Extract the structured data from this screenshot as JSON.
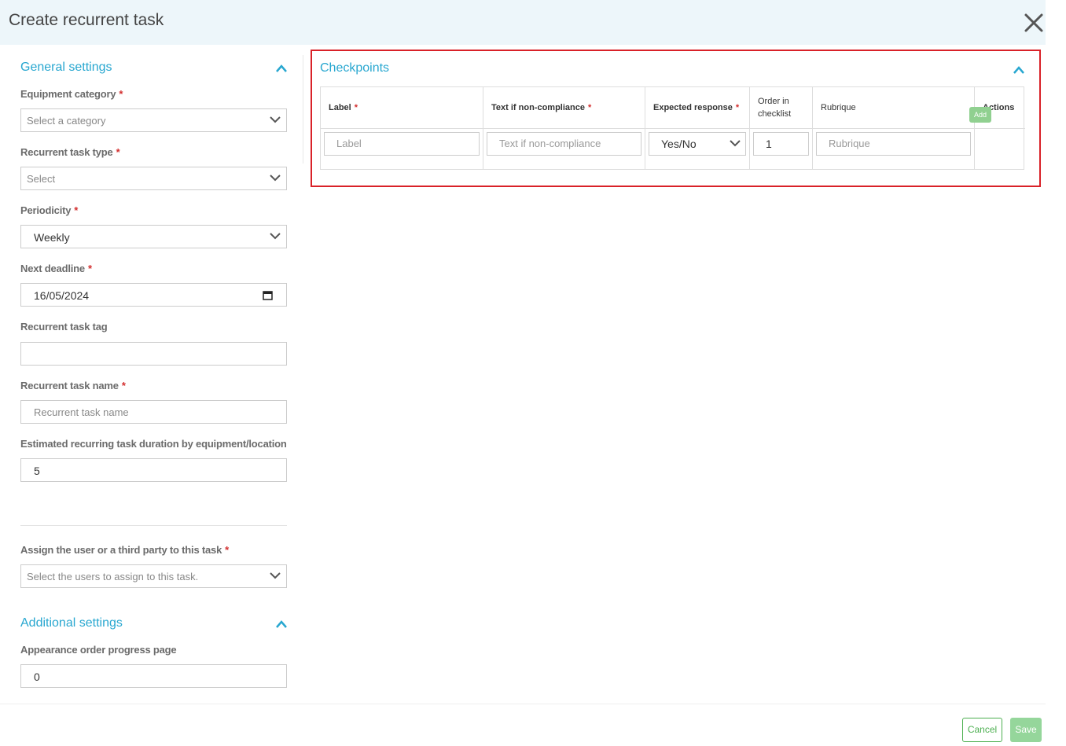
{
  "header": {
    "title": "Create recurrent task"
  },
  "general": {
    "title": "General settings",
    "equipment_category": {
      "label": "Equipment category",
      "placeholder": "Select a category"
    },
    "task_type": {
      "label": "Recurrent task type",
      "placeholder": "Select"
    },
    "periodicity": {
      "label": "Periodicity",
      "value": "Weekly"
    },
    "next_deadline": {
      "label": "Next deadline",
      "value": "16/05/2024"
    },
    "task_tag": {
      "label": "Recurrent task tag",
      "value": ""
    },
    "task_name": {
      "label": "Recurrent task name",
      "placeholder": "Recurrent task name"
    },
    "duration": {
      "label": "Estimated recurring task duration by equipment/location",
      "value": "5"
    },
    "assign": {
      "label": "Assign the user or a third party to this task",
      "placeholder": "Select the users to assign to this task."
    }
  },
  "additional": {
    "title": "Additional settings",
    "appearance_order": {
      "label": "Appearance order progress page",
      "value": "0"
    }
  },
  "checkpoints": {
    "title": "Checkpoints",
    "columns": [
      "Label",
      "Text if non-compliance",
      "Expected response",
      "Order in checklist",
      "Rubrique",
      "Actions"
    ],
    "row": {
      "label_placeholder": "Label",
      "noncompliance_placeholder": "Text if non-compliance",
      "expected_response": "Yes/No",
      "order": "1",
      "rubrique_placeholder": "Rubrique"
    },
    "add_label": "Add"
  },
  "footer": {
    "cancel": "Cancel",
    "save": "Save"
  },
  "colors": {
    "accent": "#28a7d0",
    "required": "#d32f2f",
    "highlight": "#d92128",
    "success": "#4caf50"
  },
  "icons": {
    "close": "close-icon",
    "collapse": "chevron-up-icon",
    "dropdown": "chevron-down-icon",
    "date": "calendar-icon"
  }
}
